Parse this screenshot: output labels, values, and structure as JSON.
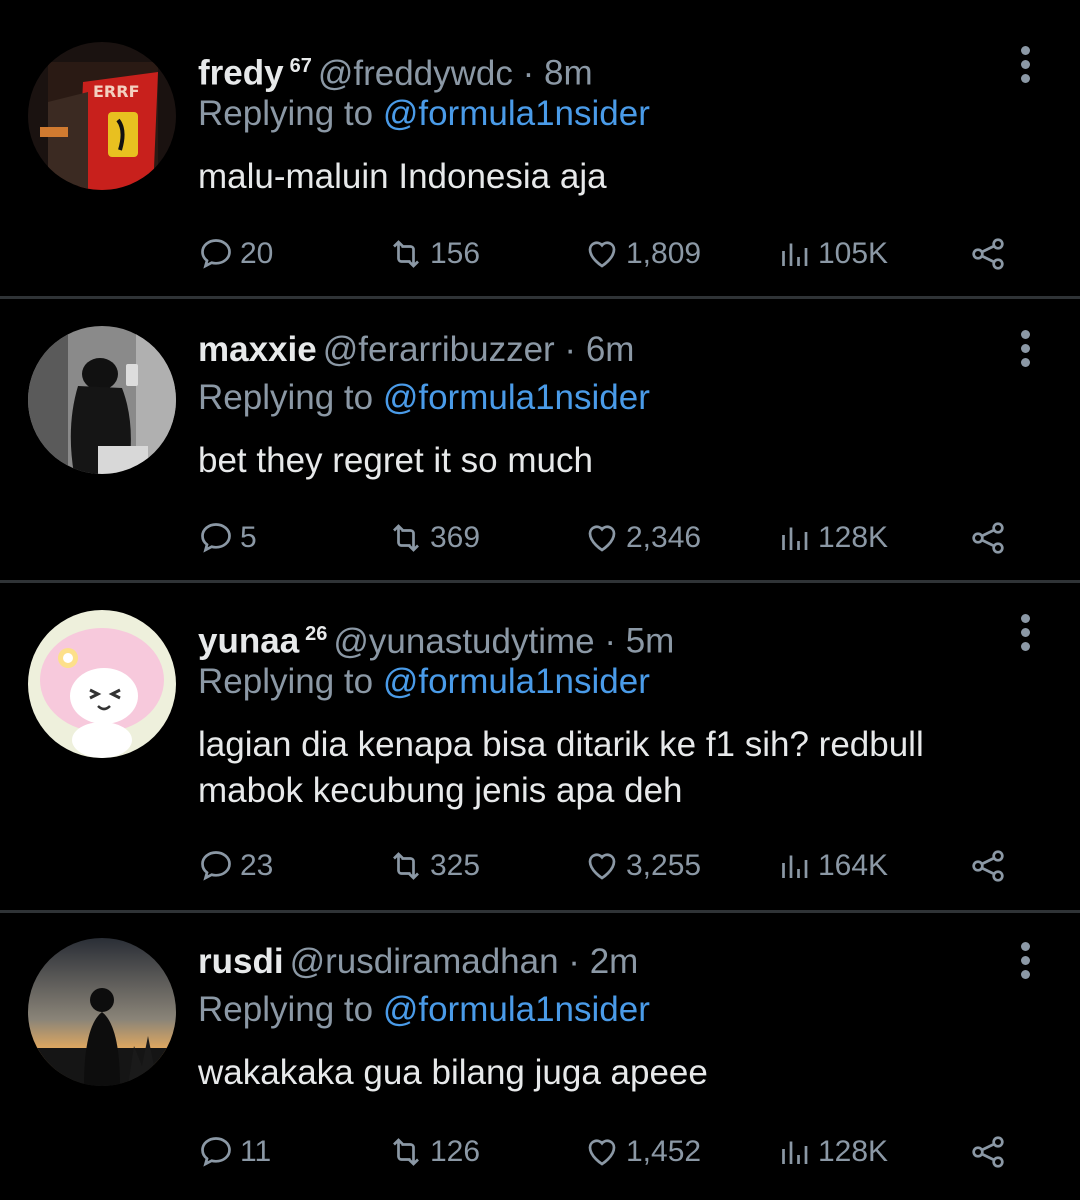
{
  "colors": {
    "background": "#000000",
    "text": "#e7e9ea",
    "muted": "#8b98a5",
    "mention": "#4a9be8",
    "divider": "#2f3336"
  },
  "icons": {
    "reply": "speech-bubble-icon",
    "retweet": "retweet-icon",
    "like": "heart-icon",
    "views": "bar-chart-icon",
    "share": "share-icon",
    "more": "more-vertical-icon"
  },
  "replies": [
    {
      "name": "fredy",
      "badge": "67",
      "handle": "@freddywdc",
      "dot": " · ",
      "time": "8m",
      "replying_prefix": "Replying to ",
      "replying_to": "@formula1nsider",
      "text": "malu-maluin Indonesia aja",
      "comments": "20",
      "retweets": "156",
      "likes": "1,809",
      "views": "105K"
    },
    {
      "name": "maxxie",
      "badge": "",
      "handle": "@ferarribuzzer",
      "dot": " · ",
      "time": "6m",
      "replying_prefix": "Replying to ",
      "replying_to": "@formula1nsider",
      "text": "bet they regret it so much",
      "comments": "5",
      "retweets": "369",
      "likes": "2,346",
      "views": "128K"
    },
    {
      "name": "yunaa",
      "badge": "26",
      "handle": "@yunastudytime",
      "dot": " · ",
      "time": "5m",
      "replying_prefix": "Replying to ",
      "replying_to": "@formula1nsider",
      "text": "lagian dia kenapa bisa ditarik ke f1 sih? redbull mabok kecubung jenis apa deh",
      "comments": "23",
      "retweets": "325",
      "likes": "3,255",
      "views": "164K"
    },
    {
      "name": "rusdi",
      "badge": "",
      "handle": "@rusdiramadhan",
      "dot": " · ",
      "time": "2m",
      "replying_prefix": "Replying to ",
      "replying_to": "@formula1nsider",
      "text": "wakakaka gua bilang juga apeee",
      "comments": "11",
      "retweets": "126",
      "likes": "1,452",
      "views": "128K"
    }
  ]
}
